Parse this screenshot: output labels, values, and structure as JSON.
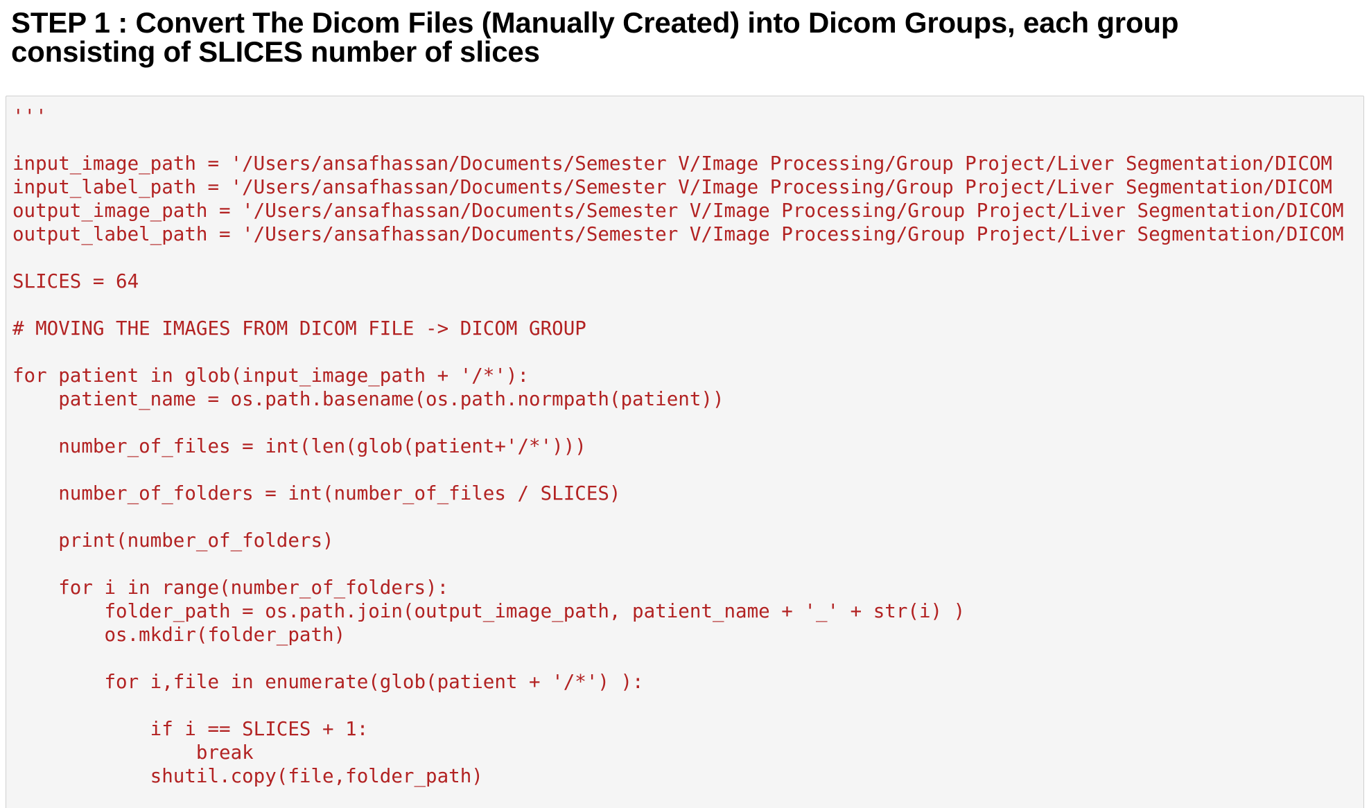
{
  "heading": {
    "line1": "STEP 1 : Convert The Dicom Files (Manually Created) into Dicom Groups, each group",
    "line2": "consisting of SLICES number of slices"
  },
  "code_cell": {
    "lines": [
      "'''",
      "",
      "input_image_path = '/Users/ansafhassan/Documents/Semester V/Image Processing/Group Project/Liver Segmentation/DICOM",
      "input_label_path = '/Users/ansafhassan/Documents/Semester V/Image Processing/Group Project/Liver Segmentation/DICOM",
      "output_image_path = '/Users/ansafhassan/Documents/Semester V/Image Processing/Group Project/Liver Segmentation/DICOM",
      "output_label_path = '/Users/ansafhassan/Documents/Semester V/Image Processing/Group Project/Liver Segmentation/DICOM",
      "",
      "SLICES = 64",
      "",
      "# MOVING THE IMAGES FROM DICOM FILE -> DICOM GROUP",
      "",
      "for patient in glob(input_image_path + '/*'):",
      "    patient_name = os.path.basename(os.path.normpath(patient))",
      "",
      "    number_of_files = int(len(glob(patient+'/*')))",
      "",
      "    number_of_folders = int(number_of_files / SLICES)",
      "",
      "    print(number_of_folders)",
      "",
      "    for i in range(number_of_folders):",
      "        folder_path = os.path.join(output_image_path, patient_name + '_' + str(i) )",
      "        os.mkdir(folder_path)",
      "",
      "        for i,file in enumerate(glob(patient + '/*') ):",
      "",
      "            if i == SLICES + 1:",
      "                break",
      "            shutil.copy(file,folder_path)"
    ]
  },
  "colors": {
    "code_text": "#b22222",
    "code_background": "#f5f5f5",
    "heading_text": "#000000"
  }
}
